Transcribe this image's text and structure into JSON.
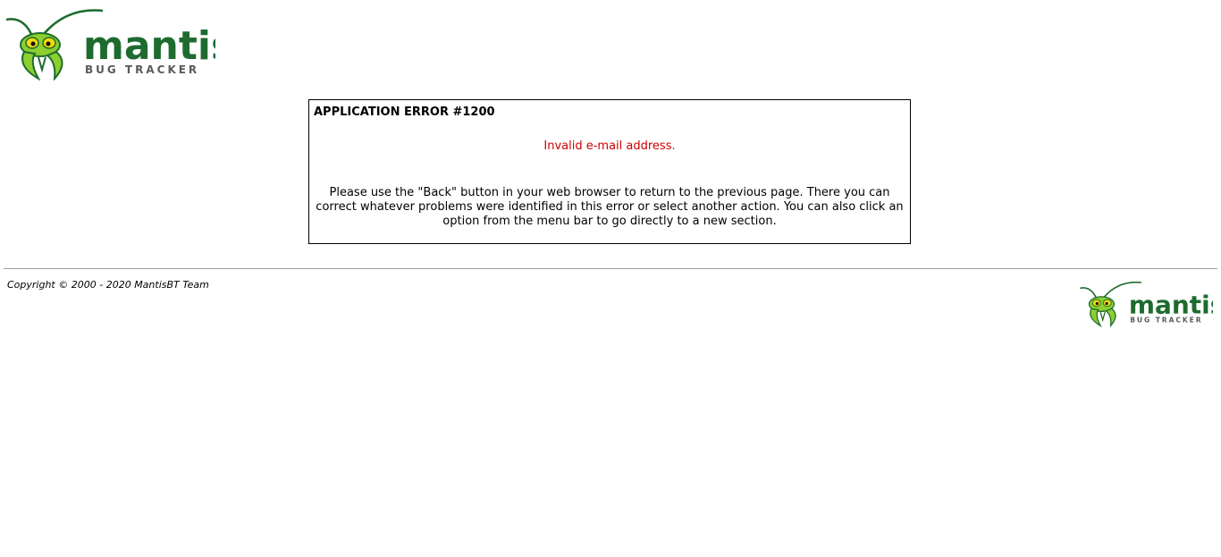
{
  "header": {
    "logo": {
      "icon": "mantis-logo",
      "brand": "mantis",
      "tagline": "BUG TRACKER",
      "colors": {
        "green": "#1e6b2f",
        "lime": "#8ccf2f",
        "eye": "#f5d90a",
        "tagline": "#5a5a5a"
      }
    }
  },
  "error": {
    "title": "APPLICATION ERROR #1200",
    "message": "Invalid e-mail address.",
    "message_color": "#cc0000",
    "help": "Please use the \"Back\" button in your web browser to return to the previous page. There you can correct whatever problems were identified in this error or select another action. You can also click an option from the menu bar to go directly to a new section."
  },
  "footer": {
    "copyright": "Copyright © 2000 - 2020 MantisBT Team",
    "logo": {
      "icon": "mantis-logo",
      "brand": "mantis",
      "tagline": "BUG TRACKER"
    }
  }
}
